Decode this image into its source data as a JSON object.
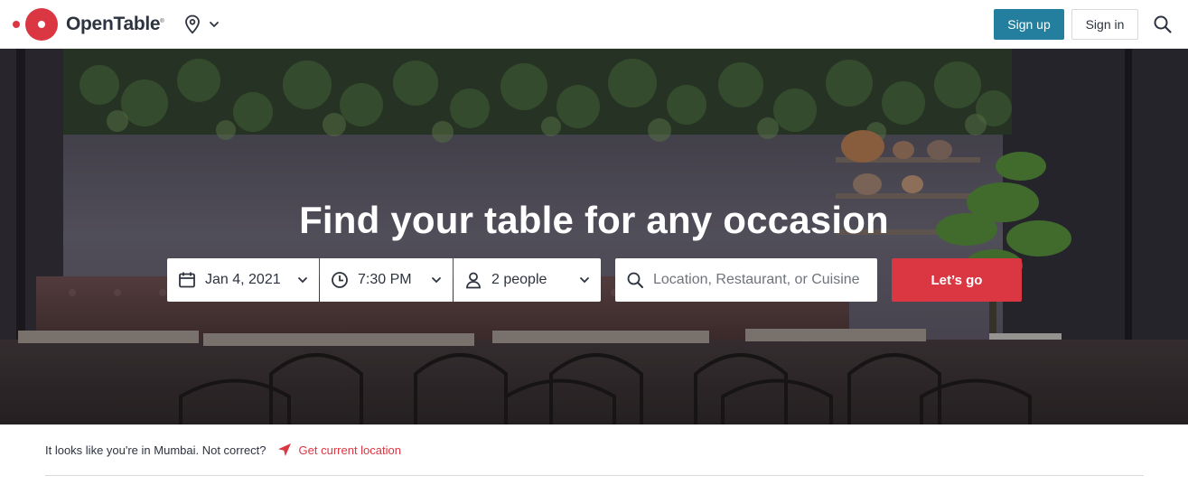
{
  "header": {
    "brand": "OpenTable",
    "brand_mark": "®",
    "location_icon": "map-pin-icon",
    "signup_label": "Sign up",
    "signin_label": "Sign in",
    "search_icon": "search-icon"
  },
  "hero": {
    "title": "Find your table for any occasion",
    "date": "Jan 4, 2021",
    "time": "7:30 PM",
    "party_size": "2 people",
    "search_placeholder": "Location, Restaurant, or Cuisine",
    "search_value": "",
    "submit_label": "Let’s go"
  },
  "location_bar": {
    "message": "It looks like you're in Mumbai. Not correct?",
    "action_label": "Get current location"
  },
  "colors": {
    "brand_red": "#da3743",
    "signup_teal": "#247f9e",
    "text_dark": "#2d333f"
  }
}
